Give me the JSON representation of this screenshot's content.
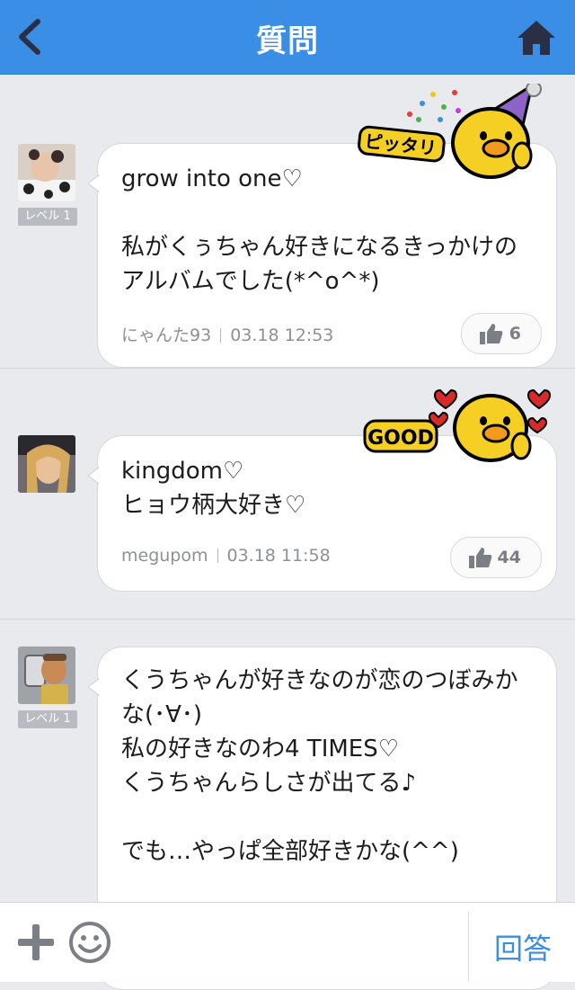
{
  "header": {
    "title": "質問"
  },
  "answers": [
    {
      "text": "grow into one♡\n\n私がくぅちゃん好きになるきっかけのアルバムでした(*^o^*)",
      "user": "にゃんた93",
      "time": "03.18 12:53",
      "likes": "6",
      "level": "レベル 1",
      "sticker_text": "ピッタリ"
    },
    {
      "text": "kingdom♡\nヒョウ柄大好き♡",
      "user": "megupom",
      "time": "03.18 11:58",
      "likes": "44",
      "sticker_text": "GOOD"
    },
    {
      "text": "くうちゃんが好きなのが恋のつぼみかな(･∀･)\n私の好きなのわ4 TIMES♡\nくうちゃんらしさが出てる♪\n\nでも…やっぱ全部好きかな(^^)",
      "level": "レベル 1"
    }
  ],
  "bottom": {
    "answer_label": "回答"
  },
  "colors": {
    "accent": "#3a8ee6",
    "background": "#e9eaed"
  }
}
